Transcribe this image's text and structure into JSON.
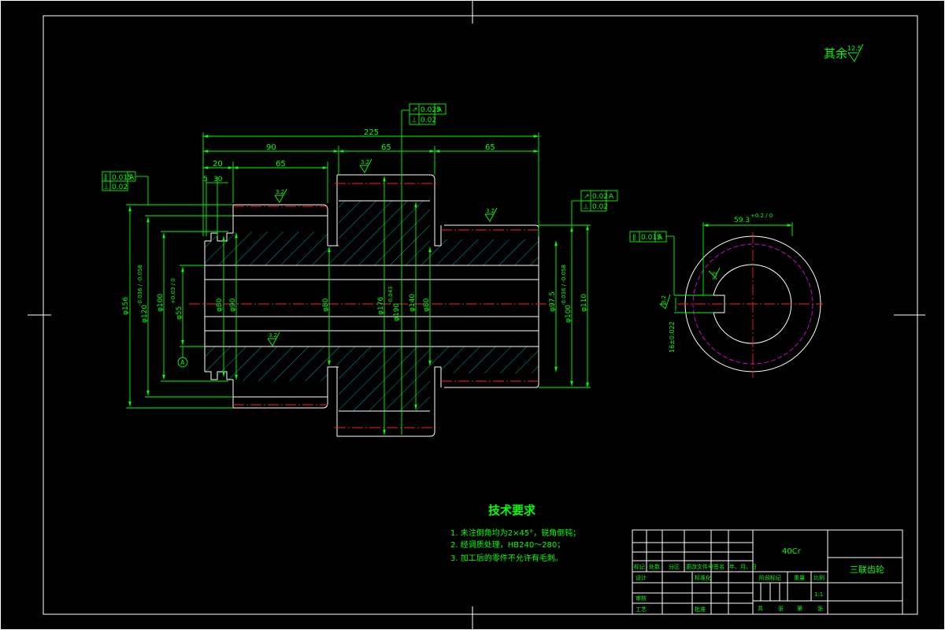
{
  "roughness_note": {
    "label": "其余",
    "value": "12.5"
  },
  "dimensions": {
    "total_length": "225",
    "len_90": "90",
    "len_65_mid": "65",
    "len_65_right": "65",
    "len_20": "20",
    "len_65_left": "65",
    "len_5": "5",
    "len_30": "30",
    "dia_156": "φ156",
    "dia_120": "φ120",
    "dia_120_tol": "-0.036 / -0.058",
    "dia_100": "φ100",
    "dia_55": "φ55",
    "dia_55_tol": "+0.03 / 0",
    "dia_80_left": "φ80",
    "dia_90_left": "φ90",
    "dia_80_mid": "φ80",
    "dia_176": "φ176",
    "dia_190": "φ190",
    "dia_190_tol": "-0.043",
    "dia_140": "φ140",
    "dia_80_right": "φ80",
    "dia_97": "φ97.5",
    "dia_100_right": "φ100",
    "dia_100_right_tol": "-0.036 / -0.058",
    "dia_110": "φ110",
    "keyway_depth": "59.3",
    "keyway_tol": "+0.2 / 0",
    "keyway_width": "16±0.022",
    "datum": "A"
  },
  "roughness_marks": {
    "top_gear": "3.2",
    "left_upper": "3.2",
    "left_lower": "3.2",
    "right_hub": "3.2",
    "keyway_side": "3.2",
    "keyway_bottom": "3.2"
  },
  "tolerance_frames": {
    "left_row1": [
      "∥",
      "0.015",
      "A"
    ],
    "left_row2": [
      "⟂",
      "0.02"
    ],
    "top_row1": [
      "↗",
      "0.025",
      "A"
    ],
    "top_row2": [
      "⟂",
      "0.02"
    ],
    "right_row1": [
      "↗",
      "0.02",
      "A"
    ],
    "right_row2": [
      "⟂",
      "0.02"
    ],
    "key_row": [
      "∥",
      "0.015",
      "A"
    ]
  },
  "technical_requirements": {
    "title": "技术要求",
    "items": [
      "1. 未注倒角均为2×45°，锐角倒钝；",
      "2. 经调质处理，HB240～280；",
      "3. 加工后的零件不允许有毛刺。"
    ]
  },
  "title_block": {
    "material": "40Cr",
    "part_name": "三联齿轮",
    "scale": "1:1",
    "header_mark": "标记",
    "header_qty": "处数",
    "header_zone": "分区",
    "header_change": "更改文件号",
    "header_sign": "签名",
    "header_date": "年、月、日",
    "row_design": "设计",
    "row_std": "标准化",
    "row_review": "审核",
    "row_process": "工艺",
    "row_approve": "批准",
    "stage_mark": "阶段标记",
    "weight": "重量",
    "ratio": "比例",
    "sheet_total": "共",
    "sheet_word": "张",
    "sheet_no": "第",
    "sheet_word2": "张"
  }
}
